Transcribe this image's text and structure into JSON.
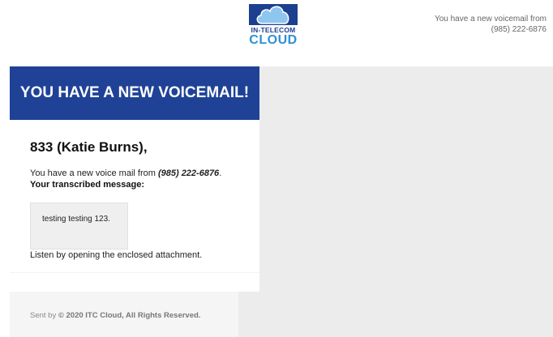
{
  "logo": {
    "line1": "IN-TELECOM",
    "line2": "CLOUD",
    "icon": "cloud-logo-icon",
    "brand_color": "#1d3f8f",
    "accent_color": "#2f8fd6"
  },
  "preheader": {
    "line1": "You have a new voicemail from",
    "line2": "(985) 222-6876"
  },
  "banner": {
    "title": "YOU HAVE A NEW VOICEMAIL!",
    "color": "#1f4296"
  },
  "body": {
    "greeting": "833 (Katie Burns),",
    "from_text": "You have a new voice mail from ",
    "from_number": "(985) 222-6876",
    "from_suffix": ".",
    "transcribed_label": "Your transcribed message:",
    "transcription": "testing testing 123.",
    "listen_text": "Listen by opening the enclosed attachment."
  },
  "footer": {
    "prefix": "Sent by ",
    "copyright": "© 2020 ITC Cloud, All Rights Reserved."
  }
}
